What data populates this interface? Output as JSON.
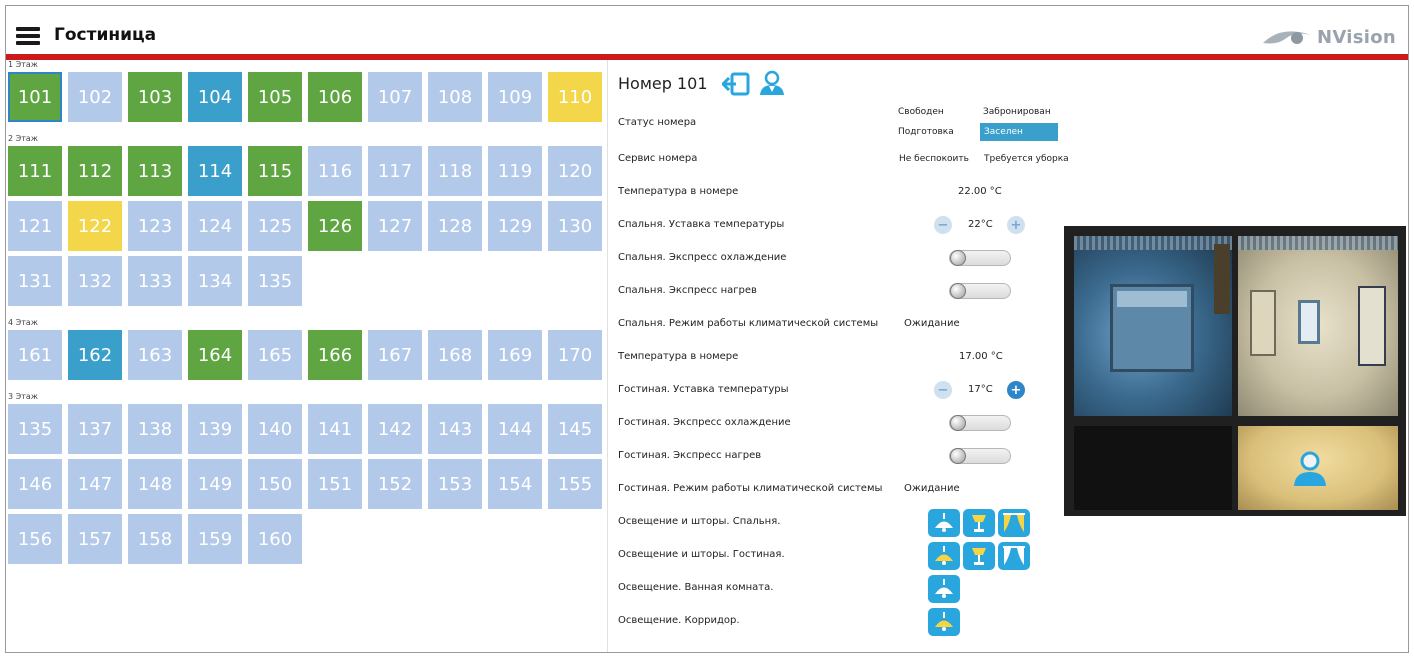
{
  "app": {
    "title": "Гостиница",
    "logo_text": "NVision"
  },
  "colors": {
    "free": "#b3c9ea",
    "occupied": "#5fa542",
    "booked": "#3a9fca",
    "prep": "#f4d64a",
    "header_bar": "#cc1a1a",
    "accent": "#2aa6de"
  },
  "floors": [
    {
      "label": "1 Этаж",
      "rooms": [
        {
          "n": "101",
          "s": "occupied",
          "sel": true
        },
        {
          "n": "102",
          "s": "free"
        },
        {
          "n": "103",
          "s": "occupied"
        },
        {
          "n": "104",
          "s": "booked"
        },
        {
          "n": "105",
          "s": "occupied"
        },
        {
          "n": "106",
          "s": "occupied"
        },
        {
          "n": "107",
          "s": "free"
        },
        {
          "n": "108",
          "s": "free"
        },
        {
          "n": "109",
          "s": "free"
        },
        {
          "n": "110",
          "s": "prep"
        }
      ]
    },
    {
      "label": "2 Этаж",
      "rooms": [
        {
          "n": "111",
          "s": "occupied"
        },
        {
          "n": "112",
          "s": "occupied"
        },
        {
          "n": "113",
          "s": "occupied"
        },
        {
          "n": "114",
          "s": "booked"
        },
        {
          "n": "115",
          "s": "occupied"
        },
        {
          "n": "116",
          "s": "free"
        },
        {
          "n": "117",
          "s": "free"
        },
        {
          "n": "118",
          "s": "free"
        },
        {
          "n": "119",
          "s": "free"
        },
        {
          "n": "120",
          "s": "free"
        },
        {
          "n": "121",
          "s": "free"
        },
        {
          "n": "122",
          "s": "prep"
        },
        {
          "n": "123",
          "s": "free"
        },
        {
          "n": "124",
          "s": "free"
        },
        {
          "n": "125",
          "s": "free"
        },
        {
          "n": "126",
          "s": "occupied"
        },
        {
          "n": "127",
          "s": "free"
        },
        {
          "n": "128",
          "s": "free"
        },
        {
          "n": "129",
          "s": "free"
        },
        {
          "n": "130",
          "s": "free"
        },
        {
          "n": "131",
          "s": "free"
        },
        {
          "n": "132",
          "s": "free"
        },
        {
          "n": "133",
          "s": "free"
        },
        {
          "n": "134",
          "s": "free"
        },
        {
          "n": "135",
          "s": "free"
        }
      ]
    },
    {
      "label": "4 Этаж",
      "rooms": [
        {
          "n": "161",
          "s": "free"
        },
        {
          "n": "162",
          "s": "booked"
        },
        {
          "n": "163",
          "s": "free"
        },
        {
          "n": "164",
          "s": "occupied"
        },
        {
          "n": "165",
          "s": "free"
        },
        {
          "n": "166",
          "s": "occupied"
        },
        {
          "n": "167",
          "s": "free"
        },
        {
          "n": "168",
          "s": "free"
        },
        {
          "n": "169",
          "s": "free"
        },
        {
          "n": "170",
          "s": "free"
        }
      ]
    },
    {
      "label": "3 Этаж",
      "rooms": [
        {
          "n": "135",
          "s": "free"
        },
        {
          "n": "137",
          "s": "free"
        },
        {
          "n": "138",
          "s": "free"
        },
        {
          "n": "139",
          "s": "free"
        },
        {
          "n": "140",
          "s": "free"
        },
        {
          "n": "141",
          "s": "free"
        },
        {
          "n": "142",
          "s": "free"
        },
        {
          "n": "143",
          "s": "free"
        },
        {
          "n": "144",
          "s": "free"
        },
        {
          "n": "145",
          "s": "free"
        },
        {
          "n": "146",
          "s": "free"
        },
        {
          "n": "147",
          "s": "free"
        },
        {
          "n": "148",
          "s": "free"
        },
        {
          "n": "149",
          "s": "free"
        },
        {
          "n": "150",
          "s": "free"
        },
        {
          "n": "151",
          "s": "free"
        },
        {
          "n": "152",
          "s": "free"
        },
        {
          "n": "153",
          "s": "free"
        },
        {
          "n": "154",
          "s": "free"
        },
        {
          "n": "155",
          "s": "free"
        },
        {
          "n": "156",
          "s": "free"
        },
        {
          "n": "157",
          "s": "free"
        },
        {
          "n": "158",
          "s": "free"
        },
        {
          "n": "159",
          "s": "free"
        },
        {
          "n": "160",
          "s": "free"
        }
      ]
    }
  ],
  "detail": {
    "title": "Номер 101",
    "status_label": "Статус номера",
    "status_options": {
      "free": "Свободен",
      "booked": "Забронирован",
      "prep": "Подготовка",
      "occupied": "Заселен"
    },
    "service_label": "Сервис номера",
    "service_options": {
      "dnd": "Не беспокоить",
      "cleaning": "Требуется уборка"
    },
    "bedroom": {
      "temp_label": "Температура в номере",
      "temp_value": "22.00 °C",
      "setpoint_label": "Спальня. Уставка температуры",
      "setpoint_value": "22°C",
      "cool_label": "Спальня. Экспресс охлаждение",
      "heat_label": "Спальня. Экспресс нагрев",
      "mode_label": "Спальня. Режим работы климатической системы",
      "mode_value": "Ожидание"
    },
    "living": {
      "temp_label": "Температура в номере",
      "temp_value": "17.00 °C",
      "setpoint_label": "Гостиная. Уставка температуры",
      "setpoint_value": "17°C",
      "cool_label": "Гостиная. Экспресс охлаждение",
      "heat_label": "Гостиная. Экспресс нагрев",
      "mode_label": "Гостиная. Режим работы климатической системы",
      "mode_value": "Ожидание"
    },
    "lighting": {
      "bedroom_label": "Освещение и шторы. Спальня.",
      "living_label": "Освещение и шторы. Гостиная.",
      "bath_label": "Освещение. Ванная комната.",
      "hall_label": "Освещение. Корридор."
    }
  }
}
